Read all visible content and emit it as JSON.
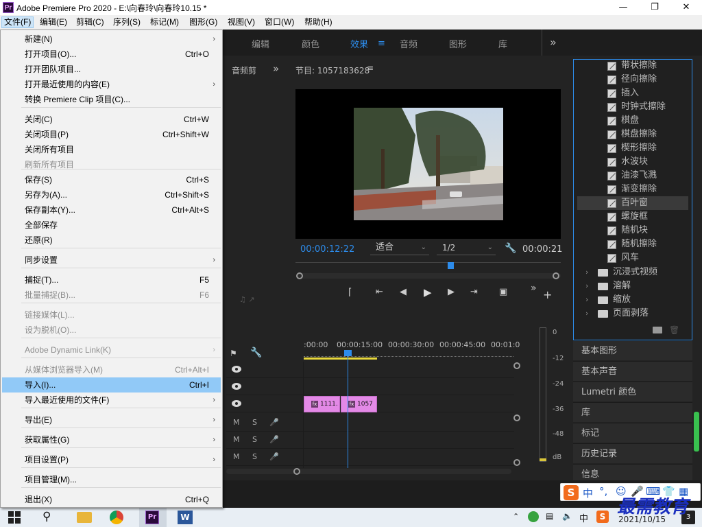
{
  "window": {
    "title": "Adobe Premiere Pro 2020 - E:\\向春玲\\向春玲10.15 *",
    "app_icon": "Pr",
    "controls": [
      "minimize-icon",
      "maximize-icon",
      "close-icon"
    ]
  },
  "menubar": [
    "文件(F)",
    "编辑(E)",
    "剪辑(C)",
    "序列(S)",
    "标记(M)",
    "图形(G)",
    "视图(V)",
    "窗口(W)",
    "帮助(H)"
  ],
  "workspace_tabs": [
    "编辑",
    "颜色",
    "效果",
    "音频",
    "图形",
    "库"
  ],
  "workspace_active": "效果",
  "file_menu": {
    "items": [
      {
        "label": "新建(N)",
        "shortcut": "",
        "submenu": true,
        "disabled": false
      },
      {
        "label": "打开项目(O)...",
        "shortcut": "Ctrl+O",
        "submenu": false,
        "disabled": false
      },
      {
        "label": "打开团队项目...",
        "shortcut": "",
        "submenu": false,
        "disabled": false
      },
      {
        "label": "打开最近使用的内容(E)",
        "shortcut": "",
        "submenu": true,
        "disabled": false
      },
      {
        "label": "转换 Premiere Clip 项目(C)...",
        "shortcut": "",
        "submenu": false,
        "disabled": false
      },
      {
        "label": "关闭(C)",
        "shortcut": "Ctrl+W",
        "submenu": false,
        "disabled": false
      },
      {
        "label": "关闭项目(P)",
        "shortcut": "Ctrl+Shift+W",
        "submenu": false,
        "disabled": false
      },
      {
        "label": "关闭所有项目",
        "shortcut": "",
        "submenu": false,
        "disabled": false
      },
      {
        "label": "刷新所有项目",
        "shortcut": "",
        "submenu": false,
        "disabled": true
      },
      {
        "label": "保存(S)",
        "shortcut": "Ctrl+S",
        "submenu": false,
        "disabled": false
      },
      {
        "label": "另存为(A)...",
        "shortcut": "Ctrl+Shift+S",
        "submenu": false,
        "disabled": false
      },
      {
        "label": "保存副本(Y)...",
        "shortcut": "Ctrl+Alt+S",
        "submenu": false,
        "disabled": false
      },
      {
        "label": "全部保存",
        "shortcut": "",
        "submenu": false,
        "disabled": false
      },
      {
        "label": "还原(R)",
        "shortcut": "",
        "submenu": false,
        "disabled": false
      },
      {
        "label": "同步设置",
        "shortcut": "",
        "submenu": true,
        "disabled": false
      },
      {
        "label": "捕捉(T)...",
        "shortcut": "F5",
        "submenu": false,
        "disabled": false
      },
      {
        "label": "批量捕捉(B)...",
        "shortcut": "F6",
        "submenu": false,
        "disabled": true
      },
      {
        "label": "链接媒体(L)...",
        "shortcut": "",
        "submenu": false,
        "disabled": true
      },
      {
        "label": "设为脱机(O)...",
        "shortcut": "",
        "submenu": false,
        "disabled": true
      },
      {
        "label": "Adobe Dynamic Link(K)",
        "shortcut": "",
        "submenu": true,
        "disabled": true
      },
      {
        "label": "从媒体浏览器导入(M)",
        "shortcut": "Ctrl+Alt+I",
        "submenu": false,
        "disabled": true
      },
      {
        "label": "导入(I)...",
        "shortcut": "Ctrl+I",
        "submenu": false,
        "disabled": false,
        "highlighted": true
      },
      {
        "label": "导入最近使用的文件(F)",
        "shortcut": "",
        "submenu": true,
        "disabled": false
      },
      {
        "label": "导出(E)",
        "shortcut": "",
        "submenu": true,
        "disabled": false
      },
      {
        "label": "获取属性(G)",
        "shortcut": "",
        "submenu": true,
        "disabled": false
      },
      {
        "label": "项目设置(P)",
        "shortcut": "",
        "submenu": true,
        "disabled": false
      },
      {
        "label": "项目管理(M)...",
        "shortcut": "",
        "submenu": false,
        "disabled": false
      },
      {
        "label": "退出(X)",
        "shortcut": "Ctrl+Q",
        "submenu": false,
        "disabled": false
      }
    ]
  },
  "audio_panel_label": "音频剪",
  "program_monitor": {
    "title": "节目: 1057183628",
    "timecode_left": "00:00:12:22",
    "fit": "适合",
    "resolution": "1/2",
    "timecode_right": "00:00:21"
  },
  "timeline": {
    "ruler": [
      ":00:00",
      "00:00:15:00",
      "00:00:30:00",
      "00:00:45:00",
      "00:01:0"
    ],
    "clips": [
      "1111.",
      "1057"
    ],
    "audio_labels": {
      "m": "M",
      "s": "S"
    }
  },
  "meter_labels": [
    "-12",
    "-24",
    "-36",
    "-48",
    "dB"
  ],
  "meter_zero": "0",
  "effects": {
    "transitions": [
      "带状擦除",
      "径向擦除",
      "插入",
      "时钟式擦除",
      "棋盘",
      "棋盘擦除",
      "楔形擦除",
      "水波块",
      "油漆飞溅",
      "渐变擦除",
      "百叶窗",
      "螺旋框",
      "随机块",
      "随机擦除",
      "风车"
    ],
    "selected": "百叶窗",
    "folders": [
      "沉浸式视频",
      "溶解",
      "缩放",
      "页面剥落"
    ]
  },
  "side_panels": [
    "基本图形",
    "基本声音",
    "Lumetri 颜色",
    "库",
    "标记",
    "历史记录",
    "信息"
  ],
  "taskbar": {
    "date": "2021/10/15",
    "tray_text": "中"
  },
  "ime_bar": {
    "label": "中"
  },
  "watermark": "最需教育",
  "colors": {
    "accent": "#2d8ceb",
    "clip": "#e389e6",
    "menu_highlight": "#91c9f7",
    "playhead": "#2d8ceb"
  }
}
